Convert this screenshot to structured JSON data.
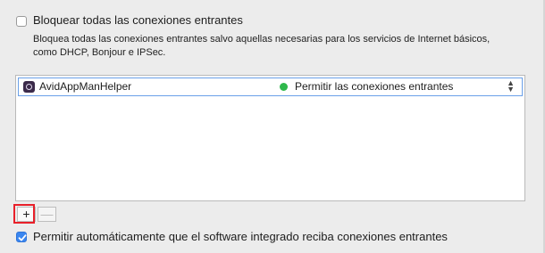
{
  "block_all": {
    "checked": false,
    "label": "Bloquear todas las conexiones entrantes",
    "description": "Bloquea todas las conexiones entrantes salvo aquellas necesarias para los servicios de Internet básicos, como DHCP, Bonjour e IPSec."
  },
  "apps": [
    {
      "name": "AvidAppManHelper",
      "icon": "app-icon",
      "status_color": "#2fb84b",
      "status": "Permitir las conexiones entrantes"
    }
  ],
  "buttons": {
    "add_label": "+",
    "remove_label": "—"
  },
  "auto_allow": {
    "checked": true,
    "label": "Permitir automáticamente que el software integrado reciba conexiones entrantes"
  },
  "colors": {
    "accent": "#3a86f0",
    "highlight": "#e8202a"
  }
}
